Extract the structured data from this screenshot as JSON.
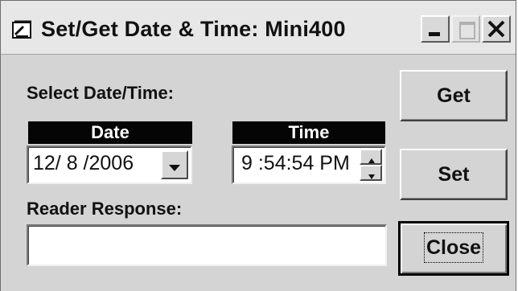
{
  "window": {
    "title": "Set/Get Date & Time: Mini400",
    "icon": "app-edit-icon",
    "controls": [
      "minimize-icon",
      "maximize-icon",
      "close-icon"
    ]
  },
  "form": {
    "select_label": "Select Date/Time:",
    "date_header": "Date",
    "date_value": "12/ 8 /2006",
    "time_header": "Time",
    "time_value": "9 :54:54 PM",
    "response_label": "Reader Response:",
    "response_value": ""
  },
  "buttons": {
    "get": "Get",
    "set": "Set",
    "close": "Close"
  },
  "colors": {
    "window_bg": "#d4d4d4",
    "header_bg": "#050505",
    "header_text": "#ffffff"
  }
}
